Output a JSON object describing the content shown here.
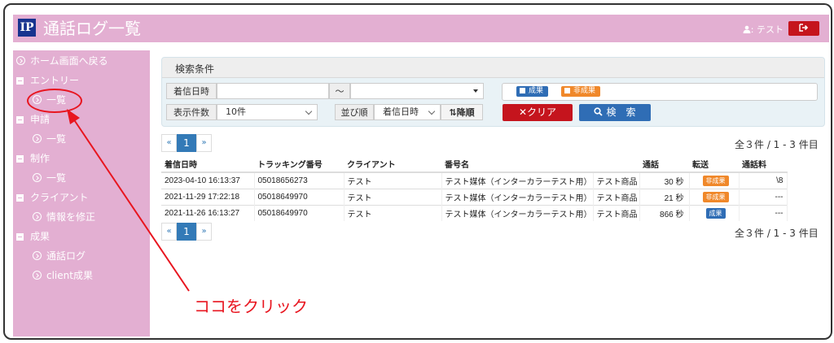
{
  "header": {
    "logo": "IP",
    "title": "通話ログ一覧",
    "user": ": テスト",
    "logout_icon": "sign-out-icon"
  },
  "sidebar": {
    "home": "ホーム画面へ戻る",
    "sections": [
      {
        "label": "エントリー",
        "items": [
          "一覧"
        ]
      },
      {
        "label": "申請",
        "items": [
          "一覧"
        ]
      },
      {
        "label": "制作",
        "items": [
          "一覧"
        ]
      },
      {
        "label": "クライアント",
        "items": [
          "情報を修正"
        ]
      },
      {
        "label": "成果",
        "items": [
          "通話ログ",
          "client成果"
        ]
      }
    ]
  },
  "search": {
    "title": "検索条件",
    "date_label": "着信日時",
    "date_from": "",
    "tilde": "〜",
    "date_to": "",
    "count_label": "表示件数",
    "count_value": "10件",
    "sort_label": "並び順",
    "sort_value": "着信日時",
    "sort_order": "降順",
    "tag_success": "成果",
    "tag_fail": "非成果",
    "clear_button": "クリア",
    "search_button": "検　索"
  },
  "pager": {
    "prev": "«",
    "page": "1",
    "next": "»"
  },
  "count_text": "全３件 / 1 - 3 件目",
  "table": {
    "headers": [
      "着信日時",
      "トラッキング番号",
      "クライアント",
      "番号名",
      "",
      "通話",
      "転送",
      "通話料"
    ],
    "rows": [
      [
        "2023-04-10 16:13:37",
        "05018656273",
        "テスト",
        "テスト媒体（インターカラーテスト用）",
        "テスト商品",
        "30 秒",
        "非成果",
        "\\8"
      ],
      [
        "2021-11-29 17:22:18",
        "05018649970",
        "テスト",
        "テスト媒体（インターカラーテスト用）",
        "テスト商品",
        "21 秒",
        "非成果",
        "---"
      ],
      [
        "2021-11-26 16:13:27",
        "05018649970",
        "テスト",
        "テスト媒体（インターカラーテスト用）",
        "テスト商品",
        "866 秒",
        "成果",
        "---"
      ]
    ]
  },
  "annotation": "ココをクリック",
  "colors": {
    "accent_pink": "#e3afd2",
    "brand_navy": "#17338f",
    "danger": "#c5141d",
    "primary": "#2f6db5",
    "fail_badge": "#f0882a",
    "success_badge": "#2f6db5",
    "annotation": "#e8151f"
  }
}
